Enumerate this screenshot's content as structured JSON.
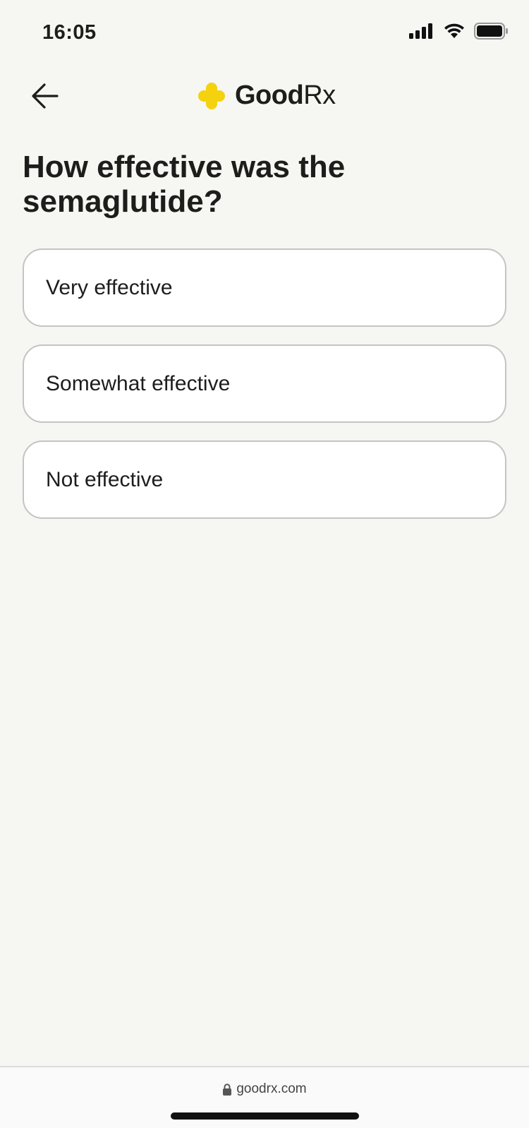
{
  "status_bar": {
    "time": "16:05"
  },
  "header": {
    "logo_bold": "Good",
    "logo_rx": "Rx",
    "accent_color": "#f5d20e"
  },
  "question": {
    "title": "How effective was the semaglutide?"
  },
  "options": [
    {
      "label": "Very effective"
    },
    {
      "label": "Somewhat effective"
    },
    {
      "label": "Not effective"
    }
  ],
  "browser": {
    "url": "goodrx.com"
  }
}
